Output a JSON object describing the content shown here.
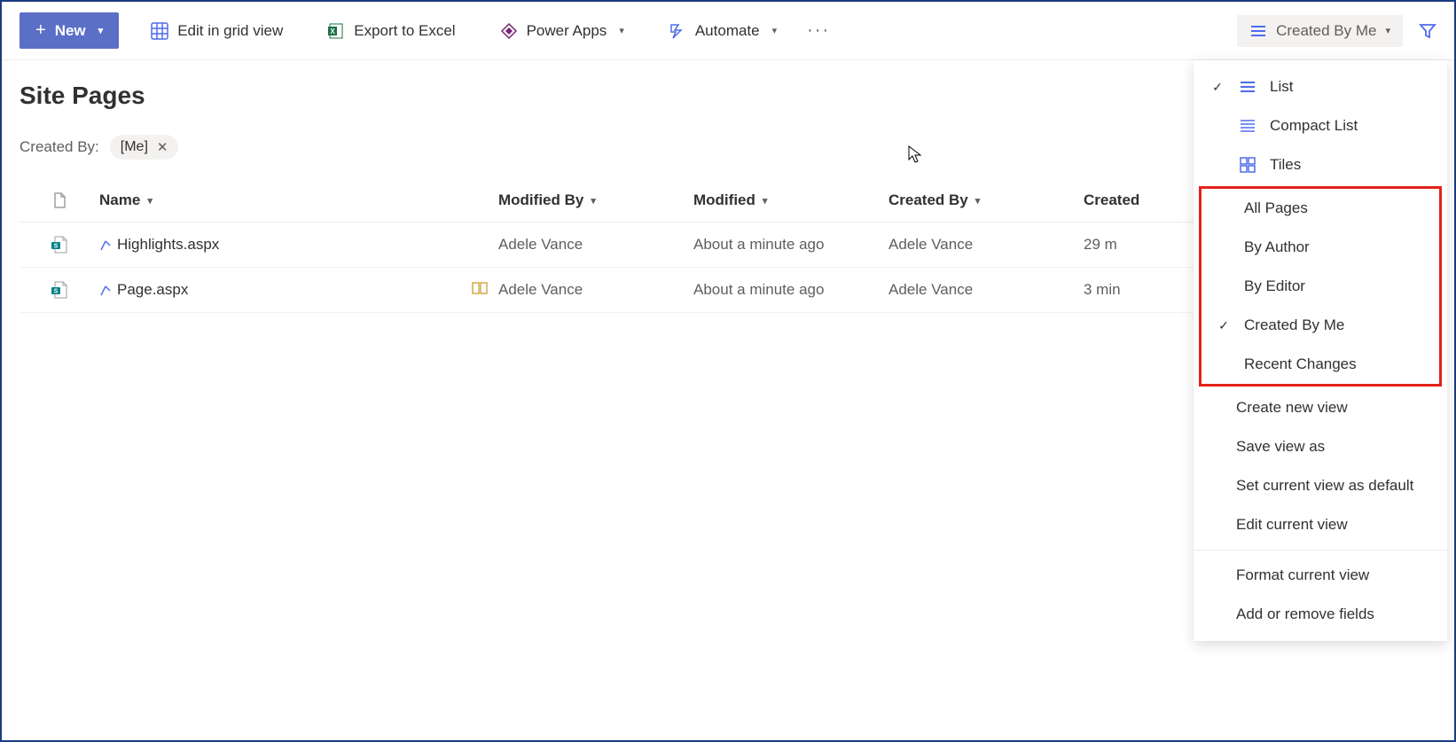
{
  "toolbar": {
    "new_label": "New",
    "grid_label": "Edit in grid view",
    "export_label": "Export to Excel",
    "powerapps_label": "Power Apps",
    "automate_label": "Automate",
    "view_label": "Created By Me"
  },
  "page_title": "Site Pages",
  "filter": {
    "label": "Created By:",
    "chip": "[Me]"
  },
  "columns": {
    "name": "Name",
    "modified_by": "Modified By",
    "modified": "Modified",
    "created_by": "Created By",
    "created": "Created"
  },
  "rows": [
    {
      "name": "Highlights.aspx",
      "modified_by": "Adele Vance",
      "modified": "About a minute ago",
      "created_by": "Adele Vance",
      "created": "29 m",
      "has_extra_icon": false
    },
    {
      "name": "Page.aspx",
      "modified_by": "Adele Vance",
      "modified": "About a minute ago",
      "created_by": "Adele Vance",
      "created": "3 min",
      "has_extra_icon": true
    }
  ],
  "dropdown": {
    "layouts": [
      {
        "label": "List",
        "icon": "list",
        "selected": true
      },
      {
        "label": "Compact List",
        "icon": "compact",
        "selected": false
      },
      {
        "label": "Tiles",
        "icon": "tiles",
        "selected": false
      }
    ],
    "views": [
      {
        "label": "All Pages",
        "selected": false
      },
      {
        "label": "By Author",
        "selected": false
      },
      {
        "label": "By Editor",
        "selected": false
      },
      {
        "label": "Created By Me",
        "selected": true
      },
      {
        "label": "Recent Changes",
        "selected": false
      }
    ],
    "actions1": [
      "Create new view",
      "Save view as",
      "Set current view as default",
      "Edit current view"
    ],
    "actions2": [
      "Format current view",
      "Add or remove fields"
    ]
  }
}
